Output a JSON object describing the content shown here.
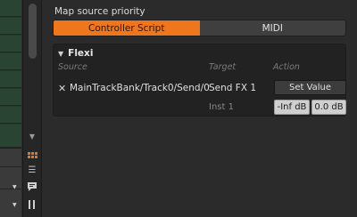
{
  "mapping": {
    "section_title": "Map source priority",
    "options": [
      {
        "label": "Controller Script",
        "active": true
      },
      {
        "label": "MIDI",
        "active": false
      }
    ]
  },
  "flexi": {
    "title": "Flexi",
    "columns": {
      "source": "Source",
      "target": "Target",
      "action": "Action"
    },
    "rows": [
      {
        "source": "MainTrackBank/Track0/Send/0",
        "target": "Send FX 1",
        "action_label": "Set Value",
        "sub_target": "Inst 1",
        "min_value": "-Inf dB",
        "max_value": "0.0 dB"
      }
    ]
  },
  "icons": {
    "collapse": "triangle-down-icon",
    "remove": "close-icon",
    "scroll_down": "chevron-down-icon",
    "grid": "grid-icon",
    "list": "list-icon",
    "comment": "speech-bubble-icon",
    "mixer": "mixer-icon"
  },
  "colors": {
    "accent": "#f0761c",
    "panel_bg": "#2b2b2b",
    "box_bg": "#222222",
    "track_green": "#2a4433"
  }
}
